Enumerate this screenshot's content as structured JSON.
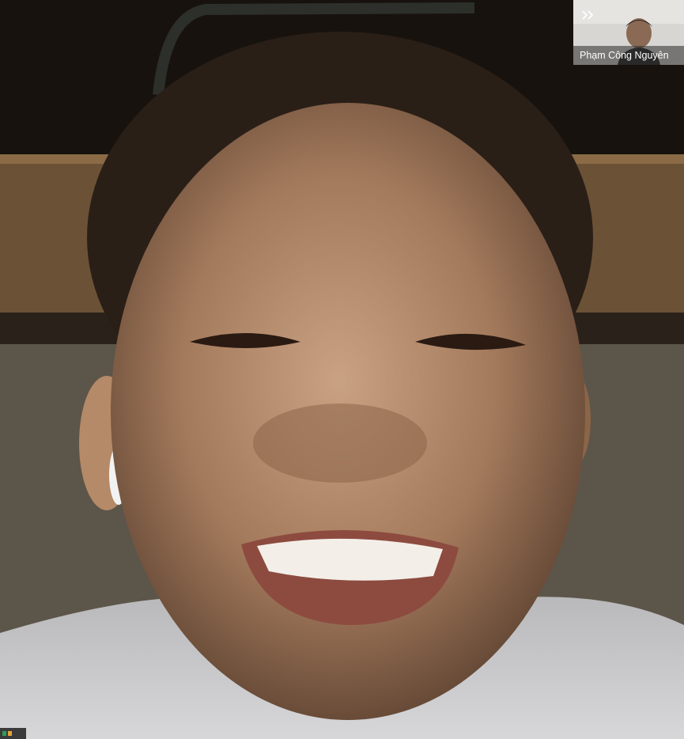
{
  "call": {
    "remote_participant": {
      "description_icon": "video-feed"
    },
    "self_view": {
      "name": "Phạm Công Nguyên",
      "collapse_icon": "double-chevron-right-icon"
    }
  },
  "colors": {
    "name_overlay": "#3a3a3a",
    "name_text": "#ffffff",
    "self_bg": "#d8d6d2"
  }
}
